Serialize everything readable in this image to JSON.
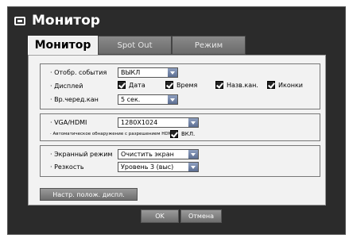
{
  "window": {
    "title": "Монитор"
  },
  "tabs": [
    {
      "label": "Монитор"
    },
    {
      "label": "Spot Out"
    },
    {
      "label": "Режим"
    }
  ],
  "group1": {
    "event_label": "· Отобр. события",
    "event_value": "ВЫКЛ",
    "display_label": "· Дисплей",
    "display_checks": [
      {
        "label": "Дата"
      },
      {
        "label": "Время"
      },
      {
        "label": "Назв.кан."
      },
      {
        "label": "Иконки"
      }
    ],
    "seq_label": "· Вр.черед.кан",
    "seq_value": "5 сек."
  },
  "group2": {
    "vga_label": "· VGA/HDMI",
    "vga_value": "1280X1024",
    "auto_label": "· Автоматическое обнаружение с разрешением HDMI",
    "auto_check_label": "ВКЛ."
  },
  "group3": {
    "screen_label": "· Экранный режим",
    "screen_value": "Очистить экран",
    "sharp_label": "· Резкость",
    "sharp_value": "Уровень 3 (выс)"
  },
  "position_button": "Настр. полож. диспл.",
  "ok_button": "OK",
  "cancel_button": "Отмена"
}
